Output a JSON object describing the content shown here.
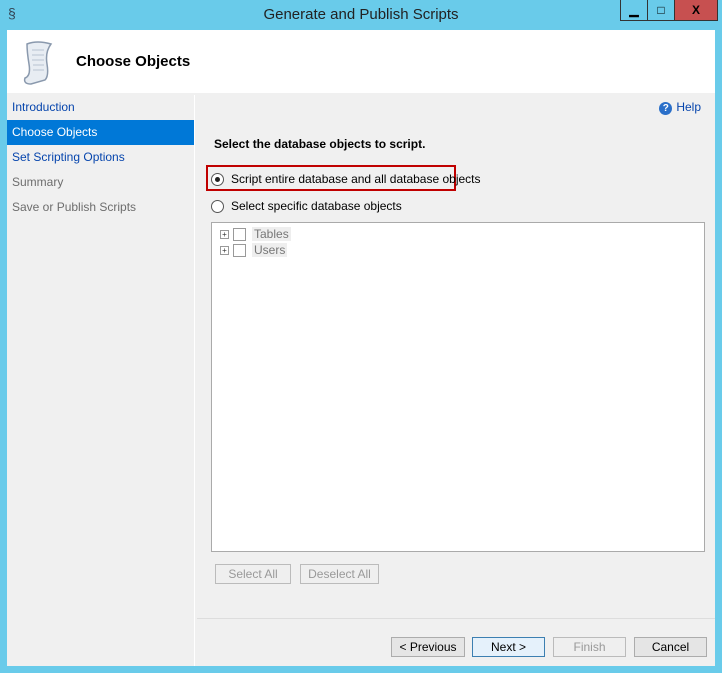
{
  "window": {
    "title": "Generate and Publish Scripts",
    "minimize": "▁",
    "maximize": "□",
    "close": "X"
  },
  "header": {
    "title": "Choose Objects",
    "icon": "script-scroll-icon"
  },
  "sidebar": {
    "items": [
      {
        "label": "Introduction",
        "state": "link"
      },
      {
        "label": "Choose Objects",
        "state": "selected"
      },
      {
        "label": "Set Scripting Options",
        "state": "link"
      },
      {
        "label": "Summary",
        "state": "disabled"
      },
      {
        "label": "Save or Publish Scripts",
        "state": "disabled"
      }
    ]
  },
  "main": {
    "help": "Help",
    "help_icon": "?",
    "prompt": "Select the database objects to script.",
    "option_all": "Script entire database and all database objects",
    "option_specific": "Select specific database objects",
    "selected_option": "option_all",
    "tree": [
      {
        "label": "Tables",
        "checked": false
      },
      {
        "label": "Users",
        "checked": false
      }
    ],
    "select_all": "Select All",
    "deselect_all": "Deselect All"
  },
  "footer": {
    "previous": "< Previous",
    "next": "Next >",
    "finish": "Finish",
    "cancel": "Cancel"
  },
  "colors": {
    "highlight": "#c00000",
    "selected": "#0078d7",
    "titlebar": "#69cbea"
  }
}
